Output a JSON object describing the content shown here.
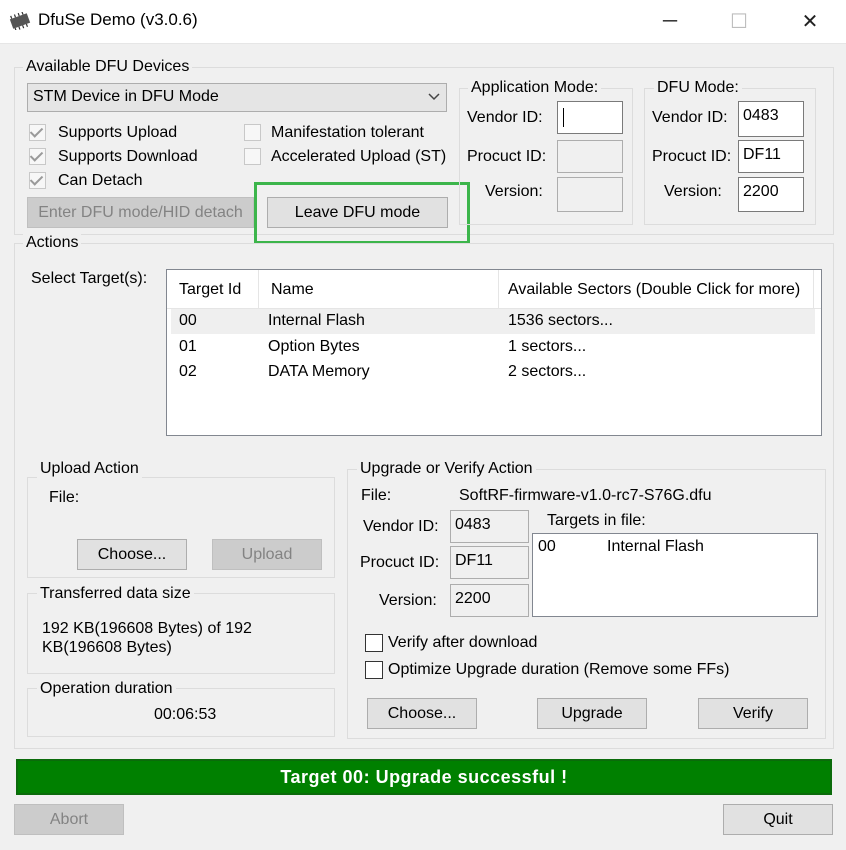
{
  "window": {
    "title": "DfuSe Demo (v3.0.6)",
    "minimize": "─",
    "maximize": "☐",
    "close": "✕"
  },
  "devices": {
    "group_label": "Available DFU Devices",
    "selected_device": "STM Device in DFU Mode",
    "supports_upload": "Supports Upload",
    "supports_download": "Supports Download",
    "can_detach": "Can Detach",
    "manifestation_tolerant": "Manifestation tolerant",
    "accelerated_upload": "Accelerated Upload (ST)",
    "enter_dfu_button": "Enter DFU mode/HID detach",
    "leave_dfu_button": "Leave DFU mode"
  },
  "app_mode": {
    "label": "Application Mode:",
    "vendor_label": "Vendor ID:",
    "product_label": "Procuct ID:",
    "version_label": "Version:",
    "vendor_value": "",
    "product_value": "",
    "version_value": ""
  },
  "dfu_mode": {
    "label": "DFU Mode:",
    "vendor_label": "Vendor ID:",
    "product_label": "Procuct ID:",
    "version_label": "Version:",
    "vendor_value": "0483",
    "product_value": "DF11",
    "version_value": "2200"
  },
  "actions": {
    "group_label": "Actions",
    "select_targets_label": "Select Target(s):",
    "columns": [
      "Target Id",
      "Name",
      "Available Sectors (Double Click for more)"
    ],
    "rows": [
      {
        "id": "00",
        "name": "Internal Flash",
        "sectors": "1536 sectors..."
      },
      {
        "id": "01",
        "name": "Option Bytes",
        "sectors": "1 sectors..."
      },
      {
        "id": "02",
        "name": "DATA Memory",
        "sectors": "2 sectors..."
      }
    ]
  },
  "upload": {
    "group_label": "Upload Action",
    "file_label": "File:",
    "choose_button": "Choose...",
    "upload_button": "Upload"
  },
  "transferred": {
    "group_label": "Transferred data size",
    "line1": "192 KB(196608 Bytes) of 192",
    "line2": "KB(196608 Bytes)"
  },
  "operation": {
    "group_label": "Operation duration",
    "value": "00:06:53"
  },
  "upgrade": {
    "group_label": "Upgrade or Verify Action",
    "file_label": "File:",
    "file_name": "SoftRF-firmware-v1.0-rc7-S76G.dfu",
    "vendor_label": "Vendor ID:",
    "product_label": "Procuct ID:",
    "version_label": "Version:",
    "vendor_value": "0483",
    "product_value": "DF11",
    "version_value": "2200",
    "targets_label": "Targets in file:",
    "target_id": "00",
    "target_name": "Internal Flash",
    "verify_after_download": "Verify after download",
    "optimize_upgrade": "Optimize Upgrade duration (Remove some FFs)",
    "choose_button": "Choose...",
    "upgrade_button": "Upgrade",
    "verify_button": "Verify"
  },
  "status": {
    "message": "Target 00: Upgrade successful !",
    "color": "#008000"
  },
  "bottom": {
    "abort_button": "Abort",
    "quit_button": "Quit"
  }
}
